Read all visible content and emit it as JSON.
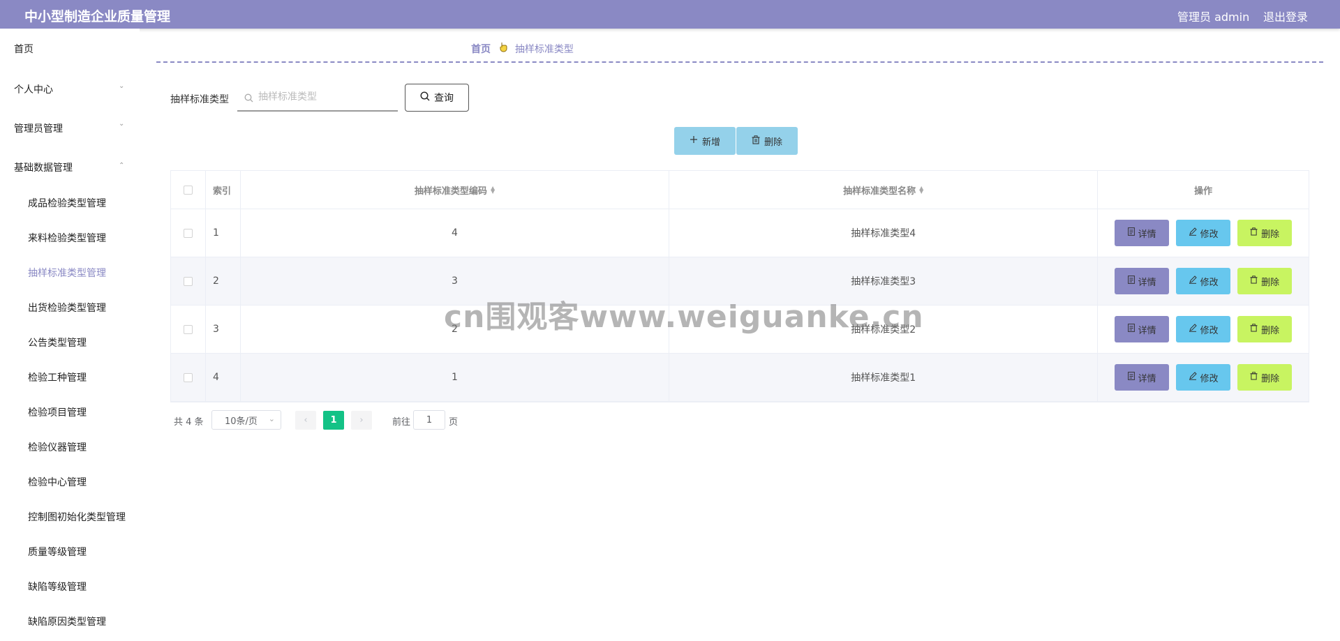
{
  "header": {
    "title": "中小型制造企业质量管理",
    "user": "管理员 admin",
    "logout": "退出登录"
  },
  "sidebar": {
    "items": [
      {
        "label": "首页"
      },
      {
        "label": "个人中心"
      },
      {
        "label": "管理员管理"
      },
      {
        "label": "基础数据管理"
      }
    ],
    "sub_items": [
      {
        "label": "成品检验类型管理"
      },
      {
        "label": "来料检验类型管理"
      },
      {
        "label": "抽样标准类型管理"
      },
      {
        "label": "出货检验类型管理"
      },
      {
        "label": "公告类型管理"
      },
      {
        "label": "检验工种管理"
      },
      {
        "label": "检验项目管理"
      },
      {
        "label": "检验仪器管理"
      },
      {
        "label": "检验中心管理"
      },
      {
        "label": "控制图初始化类型管理"
      },
      {
        "label": "质量等级管理"
      },
      {
        "label": "缺陷等级管理"
      },
      {
        "label": "缺陷原因类型管理"
      }
    ]
  },
  "breadcrumb": {
    "home": "首页",
    "current": "抽样标准类型"
  },
  "search": {
    "label": "抽样标准类型",
    "placeholder": "抽样标准类型",
    "button": "查询"
  },
  "actions": {
    "add": "新增",
    "delete": "删除"
  },
  "table": {
    "headers": {
      "index": "索引",
      "code": "抽样标准类型编码",
      "name": "抽样标准类型名称",
      "ops": "操作"
    },
    "rows": [
      {
        "index": "1",
        "code": "4",
        "name": "抽样标准类型4"
      },
      {
        "index": "2",
        "code": "3",
        "name": "抽样标准类型3"
      },
      {
        "index": "3",
        "code": "2",
        "name": "抽样标准类型2"
      },
      {
        "index": "4",
        "code": "1",
        "name": "抽样标准类型1"
      }
    ],
    "op_labels": {
      "detail": "详情",
      "edit": "修改",
      "delete": "删除"
    }
  },
  "pagination": {
    "total": "共 4 条",
    "page_size": "10条/页",
    "current_page": "1",
    "goto_label": "前往",
    "goto_value": "1",
    "goto_suffix": "页"
  },
  "watermark": "cn围观客www.weiguanke.cn",
  "colors": {
    "primary": "#8a89c4",
    "add_button": "#94d1ea",
    "detail_button": "#8a89c4",
    "edit_button": "#67c7ee",
    "delete_button": "#c8f461",
    "current_page": "#13c286"
  }
}
